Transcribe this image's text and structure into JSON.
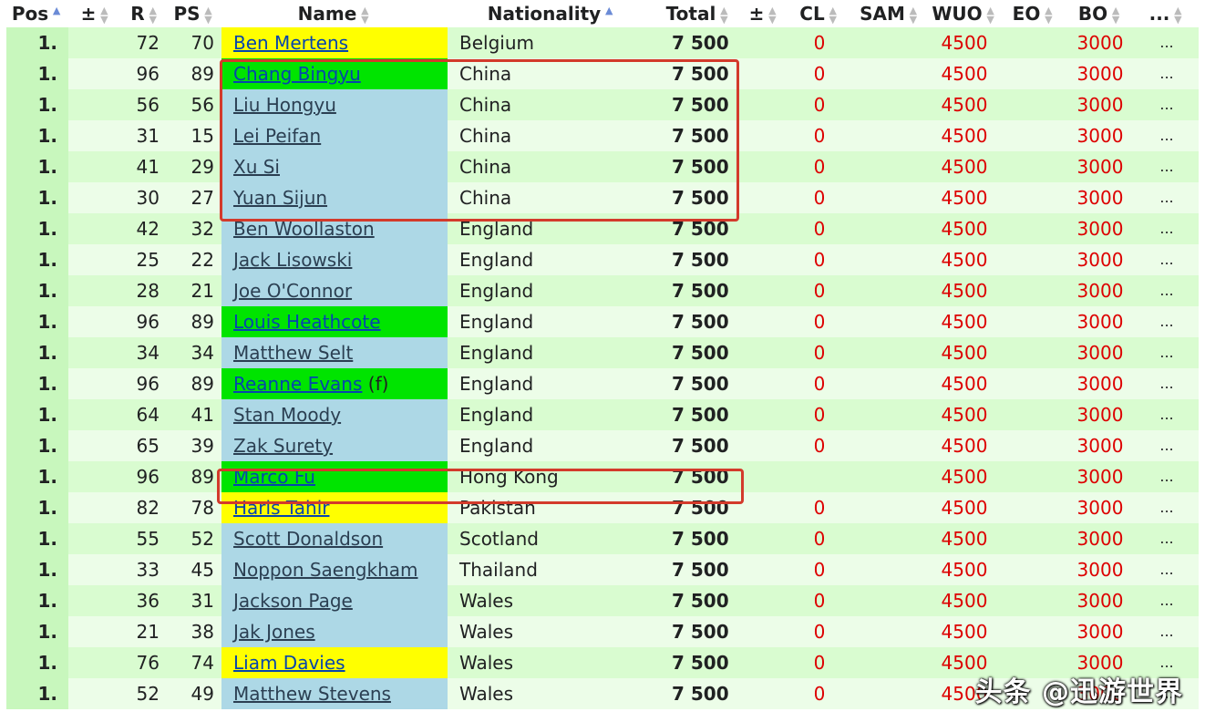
{
  "headers": [
    {
      "key": "pos",
      "label": "Pos",
      "sort": "asc"
    },
    {
      "key": "pm1",
      "label": "±",
      "sort": "none"
    },
    {
      "key": "r",
      "label": "R",
      "sort": "none"
    },
    {
      "key": "ps",
      "label": "PS",
      "sort": "none"
    },
    {
      "key": "name",
      "label": "Name",
      "sort": "none"
    },
    {
      "key": "nationality",
      "label": "Nationality",
      "sort": "asc"
    },
    {
      "key": "total",
      "label": "Total",
      "sort": "none"
    },
    {
      "key": "pm2",
      "label": "±",
      "sort": "none"
    },
    {
      "key": "cl",
      "label": "CL",
      "sort": "none"
    },
    {
      "key": "sam",
      "label": "SAM",
      "sort": "none"
    },
    {
      "key": "wuo",
      "label": "WUO",
      "sort": "none"
    },
    {
      "key": "eo",
      "label": "EO",
      "sort": "none"
    },
    {
      "key": "bo",
      "label": "BO",
      "sort": "none"
    },
    {
      "key": "more",
      "label": "...",
      "sort": "none"
    }
  ],
  "rows": [
    {
      "pos": "1.",
      "r": "72",
      "ps": "70",
      "name": "Ben Mertens",
      "name_suffix": "",
      "name_bg": "yellow",
      "nationality": "Belgium",
      "total": "7 500",
      "cl": "0",
      "wuo": "4500",
      "bo": "3000",
      "more": "..."
    },
    {
      "pos": "1.",
      "r": "96",
      "ps": "89",
      "name": "Chang Bingyu",
      "name_suffix": "",
      "name_bg": "green",
      "nationality": "China",
      "total": "7 500",
      "cl": "0",
      "wuo": "4500",
      "bo": "3000",
      "more": "..."
    },
    {
      "pos": "1.",
      "r": "56",
      "ps": "56",
      "name": "Liu Hongyu",
      "name_suffix": "",
      "name_bg": "blue",
      "nationality": "China",
      "total": "7 500",
      "cl": "0",
      "wuo": "4500",
      "bo": "3000",
      "more": "..."
    },
    {
      "pos": "1.",
      "r": "31",
      "ps": "15",
      "name": "Lei Peifan",
      "name_suffix": "",
      "name_bg": "blue",
      "nationality": "China",
      "total": "7 500",
      "cl": "0",
      "wuo": "4500",
      "bo": "3000",
      "more": "..."
    },
    {
      "pos": "1.",
      "r": "41",
      "ps": "29",
      "name": "Xu Si",
      "name_suffix": "",
      "name_bg": "blue",
      "nationality": "China",
      "total": "7 500",
      "cl": "0",
      "wuo": "4500",
      "bo": "3000",
      "more": "..."
    },
    {
      "pos": "1.",
      "r": "30",
      "ps": "27",
      "name": "Yuan Sijun",
      "name_suffix": "",
      "name_bg": "blue",
      "nationality": "China",
      "total": "7 500",
      "cl": "0",
      "wuo": "4500",
      "bo": "3000",
      "more": "..."
    },
    {
      "pos": "1.",
      "r": "42",
      "ps": "32",
      "name": "Ben Woollaston",
      "name_suffix": "",
      "name_bg": "blue",
      "nationality": "England",
      "total": "7 500",
      "cl": "0",
      "wuo": "4500",
      "bo": "3000",
      "more": "..."
    },
    {
      "pos": "1.",
      "r": "25",
      "ps": "22",
      "name": "Jack Lisowski",
      "name_suffix": "",
      "name_bg": "blue",
      "nationality": "England",
      "total": "7 500",
      "cl": "0",
      "wuo": "4500",
      "bo": "3000",
      "more": "..."
    },
    {
      "pos": "1.",
      "r": "28",
      "ps": "21",
      "name": "Joe O'Connor",
      "name_suffix": "",
      "name_bg": "blue",
      "nationality": "England",
      "total": "7 500",
      "cl": "0",
      "wuo": "4500",
      "bo": "3000",
      "more": "..."
    },
    {
      "pos": "1.",
      "r": "96",
      "ps": "89",
      "name": "Louis Heathcote",
      "name_suffix": "",
      "name_bg": "green",
      "nationality": "England",
      "total": "7 500",
      "cl": "0",
      "wuo": "4500",
      "bo": "3000",
      "more": "..."
    },
    {
      "pos": "1.",
      "r": "34",
      "ps": "34",
      "name": "Matthew Selt",
      "name_suffix": "",
      "name_bg": "blue",
      "nationality": "England",
      "total": "7 500",
      "cl": "0",
      "wuo": "4500",
      "bo": "3000",
      "more": "..."
    },
    {
      "pos": "1.",
      "r": "96",
      "ps": "89",
      "name": "Reanne Evans",
      "name_suffix": " (f)",
      "name_bg": "green",
      "nationality": "England",
      "total": "7 500",
      "cl": "0",
      "wuo": "4500",
      "bo": "3000",
      "more": "..."
    },
    {
      "pos": "1.",
      "r": "64",
      "ps": "41",
      "name": "Stan Moody",
      "name_suffix": "",
      "name_bg": "blue",
      "nationality": "England",
      "total": "7 500",
      "cl": "0",
      "wuo": "4500",
      "bo": "3000",
      "more": "..."
    },
    {
      "pos": "1.",
      "r": "65",
      "ps": "39",
      "name": "Zak Surety",
      "name_suffix": "",
      "name_bg": "blue",
      "nationality": "England",
      "total": "7 500",
      "cl": "0",
      "wuo": "4500",
      "bo": "3000",
      "more": "..."
    },
    {
      "pos": "1.",
      "r": "96",
      "ps": "89",
      "name": "Marco Fu",
      "name_suffix": "",
      "name_bg": "green",
      "nationality": "Hong Kong",
      "total": "7 500",
      "cl": "",
      "wuo": "4500",
      "bo": "3000",
      "more": "..."
    },
    {
      "pos": "1.",
      "r": "82",
      "ps": "78",
      "name": "Haris Tahir",
      "name_suffix": "",
      "name_bg": "yellow",
      "nationality": "Pakistan",
      "total": "7 500",
      "cl": "0",
      "wuo": "4500",
      "bo": "3000",
      "more": "..."
    },
    {
      "pos": "1.",
      "r": "55",
      "ps": "52",
      "name": "Scott Donaldson",
      "name_suffix": "",
      "name_bg": "blue",
      "nationality": "Scotland",
      "total": "7 500",
      "cl": "0",
      "wuo": "4500",
      "bo": "3000",
      "more": "..."
    },
    {
      "pos": "1.",
      "r": "33",
      "ps": "45",
      "name": "Noppon Saengkham",
      "name_suffix": "",
      "name_bg": "blue",
      "nationality": "Thailand",
      "total": "7 500",
      "cl": "0",
      "wuo": "4500",
      "bo": "3000",
      "more": "..."
    },
    {
      "pos": "1.",
      "r": "36",
      "ps": "31",
      "name": "Jackson Page",
      "name_suffix": "",
      "name_bg": "blue",
      "nationality": "Wales",
      "total": "7 500",
      "cl": "0",
      "wuo": "4500",
      "bo": "3000",
      "more": "..."
    },
    {
      "pos": "1.",
      "r": "21",
      "ps": "38",
      "name": "Jak Jones",
      "name_suffix": "",
      "name_bg": "blue",
      "nationality": "Wales",
      "total": "7 500",
      "cl": "0",
      "wuo": "4500",
      "bo": "3000",
      "more": "..."
    },
    {
      "pos": "1.",
      "r": "76",
      "ps": "74",
      "name": "Liam Davies",
      "name_suffix": "",
      "name_bg": "yellow",
      "nationality": "Wales",
      "total": "7 500",
      "cl": "0",
      "wuo": "4500",
      "bo": "3000",
      "more": "..."
    },
    {
      "pos": "1.",
      "r": "52",
      "ps": "49",
      "name": "Matthew Stevens",
      "name_suffix": "",
      "name_bg": "blue",
      "nationality": "Wales",
      "total": "7 500",
      "cl": "0",
      "wuo": "4500",
      "bo": "3000",
      "more": "..."
    }
  ],
  "colors": {
    "highlight_box": "#d33a2b",
    "red_value": "#dd0000",
    "name_blue": "#add8e6",
    "name_green": "#00e400",
    "name_yellow": "#ffff00",
    "row_odd": "#d9fcd0",
    "row_even": "#ecfde8"
  },
  "watermark": "头条 @迅游世界"
}
